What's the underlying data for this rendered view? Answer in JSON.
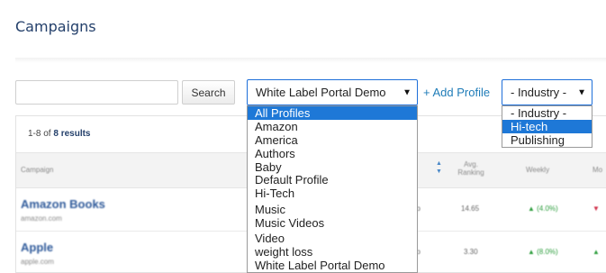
{
  "page": {
    "title": "Campaigns"
  },
  "toolbar": {
    "search_placeholder": "",
    "search_button": "Search",
    "profile_select_value": "White Label Portal Demo",
    "add_profile": "+ Add Profile",
    "industry_select_value": "- Industry -"
  },
  "profile_dropdown": {
    "options": [
      "All Profiles",
      "Amazon",
      "America",
      "Authors",
      "Baby",
      "Default Profile",
      "Hi-Tech",
      "Music",
      "Music Videos",
      "Video",
      "weight loss",
      "White Label Portal Demo"
    ],
    "highlighted": "All Profiles"
  },
  "industry_dropdown": {
    "options": [
      "- Industry -",
      "Hi-tech",
      "Publishing"
    ],
    "highlighted": "Hi-tech"
  },
  "table": {
    "results_prefix": "1-8 of",
    "results_count": "8 results",
    "columns": [
      "Campaign",
      "Avg. Ranking",
      "Weekly",
      "Mo"
    ],
    "rows": [
      {
        "name": "Amazon Books",
        "url": "amazon.com",
        "partial": "no",
        "avg": "14.65",
        "weekly": "▲ (4.0%)",
        "monthly": "▼"
      },
      {
        "name": "Apple",
        "url": "apple.com",
        "partial": "no",
        "avg": "3.30",
        "weekly": "▲ (8.0%)",
        "monthly": "▲"
      }
    ]
  },
  "colors": {
    "accent": "#1e78d7",
    "title": "#24406b",
    "link": "#1f7cb8"
  },
  "icons": {
    "sort": "sort-arrows-icon",
    "select_arrow": "caret-down-icon"
  }
}
